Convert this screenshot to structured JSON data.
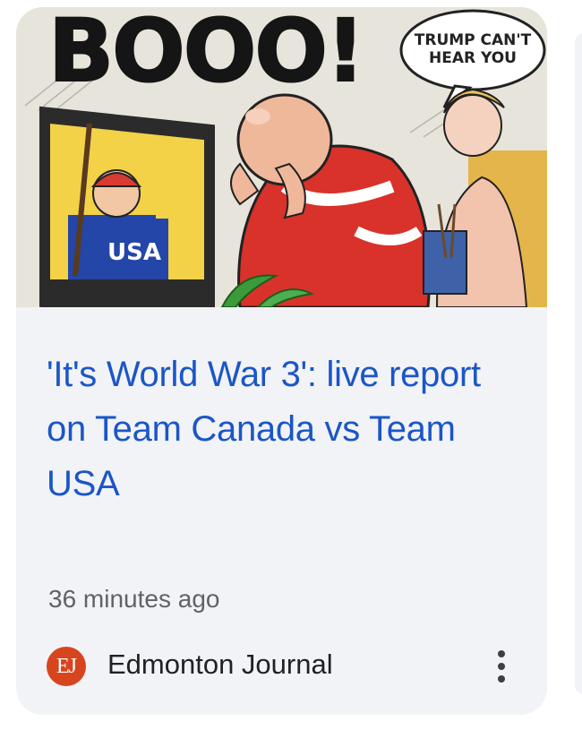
{
  "article": {
    "image": {
      "alt_subject": "editorial-cartoon",
      "banner_text": "BOOO!",
      "speech_bubble": "TRUMP CAN'T HEAR YOU",
      "jersey_text": "USA"
    },
    "headline": "'It's World War 3': live report on Team Canada vs Team USA",
    "timestamp": "36 minutes ago",
    "source": {
      "name": "Edmonton Journal",
      "logo_text": "EJ",
      "logo_color": "#d7451e"
    },
    "more_icon": "more-vert-icon"
  },
  "colors": {
    "headline": "#1a56c7",
    "card_background": "#f2f3f6",
    "meta_text": "#5f6368"
  }
}
